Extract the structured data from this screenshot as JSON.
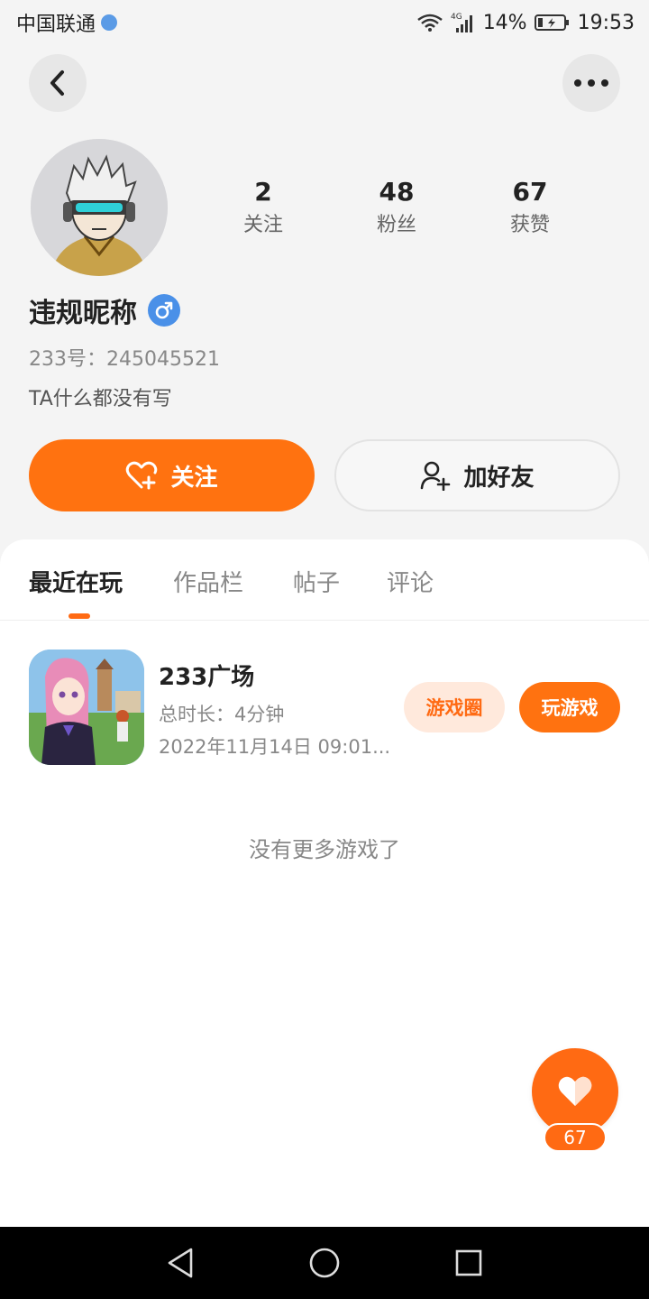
{
  "status_bar": {
    "carrier": "中国联通",
    "network": "4G",
    "battery": "14%",
    "time": "19:53"
  },
  "profile": {
    "nickname": "违规昵称",
    "uid_label": "233号：",
    "uid": "245045521",
    "bio": "TA什么都没有写",
    "stats": [
      {
        "value": "2",
        "label": "关注"
      },
      {
        "value": "48",
        "label": "粉丝"
      },
      {
        "value": "67",
        "label": "获赞"
      }
    ]
  },
  "actions": {
    "follow_label": "关注",
    "add_friend_label": "加好友"
  },
  "tabs": [
    {
      "label": "最近在玩",
      "active": true
    },
    {
      "label": "作品栏",
      "active": false
    },
    {
      "label": "帖子",
      "active": false
    },
    {
      "label": "评论",
      "active": false
    }
  ],
  "games": [
    {
      "title": "233广场",
      "duration": "总时长：4分钟",
      "last_played": "2022年11月14日 09:01...",
      "circle_label": "游戏圈",
      "play_label": "玩游戏"
    }
  ],
  "empty_hint": "没有更多游戏了",
  "like_fab": {
    "count": "67"
  },
  "colors": {
    "accent": "#ff7210",
    "accent_light": "#ffe9dc",
    "gender_male": "#4a90e8"
  },
  "icons": [
    "back-arrow-icon",
    "more-dots-icon",
    "heart-plus-icon",
    "add-person-icon",
    "male-symbol-icon",
    "heart-icon",
    "nav-back-icon",
    "nav-home-icon",
    "nav-recents-icon"
  ]
}
